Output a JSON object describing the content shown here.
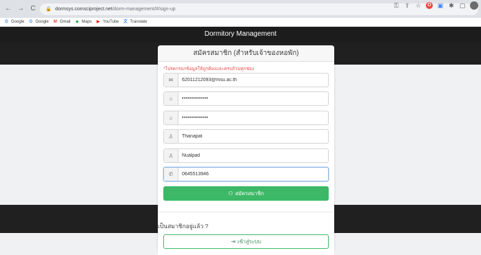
{
  "browser": {
    "url_host": "dormsys.comsciproject.net",
    "url_path": "/dorm-management/#/sign-up",
    "bookmarks": [
      {
        "label": "Google",
        "icon": "G",
        "color": "#4285f4"
      },
      {
        "label": "Google",
        "icon": "G",
        "color": "#4285f4"
      },
      {
        "label": "Gmail",
        "icon": "M",
        "color": "#ea4335"
      },
      {
        "label": "Maps",
        "icon": "◆",
        "color": "#34a853"
      },
      {
        "label": "YouTube",
        "icon": "▶",
        "color": "#ff0000"
      },
      {
        "label": "Translate",
        "icon": "文",
        "color": "#4285f4"
      }
    ]
  },
  "navbar": {
    "title": "Dormitory Management"
  },
  "form": {
    "header": "สมัครสมาชิก (สำหรับเจ้าของหอพัก)",
    "warning": "*โปรดกรอกข้อมูลให้ถูกต้องและครบถ้วนทุกช่อง",
    "fields": [
      {
        "icon": "envelope-icon",
        "glyph": "✉",
        "value": "62011212093@msu.ac.th",
        "type": "text"
      },
      {
        "icon": "lock-icon",
        "glyph": "🔒",
        "value": "•••••••••••••",
        "type": "password"
      },
      {
        "icon": "lock-icon",
        "glyph": "🔒",
        "value": "•••••••••••••",
        "type": "password"
      },
      {
        "icon": "user-icon",
        "glyph": "👤",
        "value": "Thanapat",
        "type": "text"
      },
      {
        "icon": "user-icon",
        "glyph": "👤",
        "value": "Nualpad",
        "type": "text"
      },
      {
        "icon": "phone-icon",
        "glyph": "✆",
        "value": "0645513946",
        "type": "text"
      }
    ],
    "submit_label": "สมัครสมาชิก"
  },
  "login_section": {
    "text": "เป็นสมาชิกอยู่แล้ว ?",
    "button_label": "เข้าสู่ระบบ"
  },
  "colors": {
    "accent_green": "#3cb866",
    "warning_red": "#e84a4a",
    "navbar_bg": "#1c1c1c"
  }
}
